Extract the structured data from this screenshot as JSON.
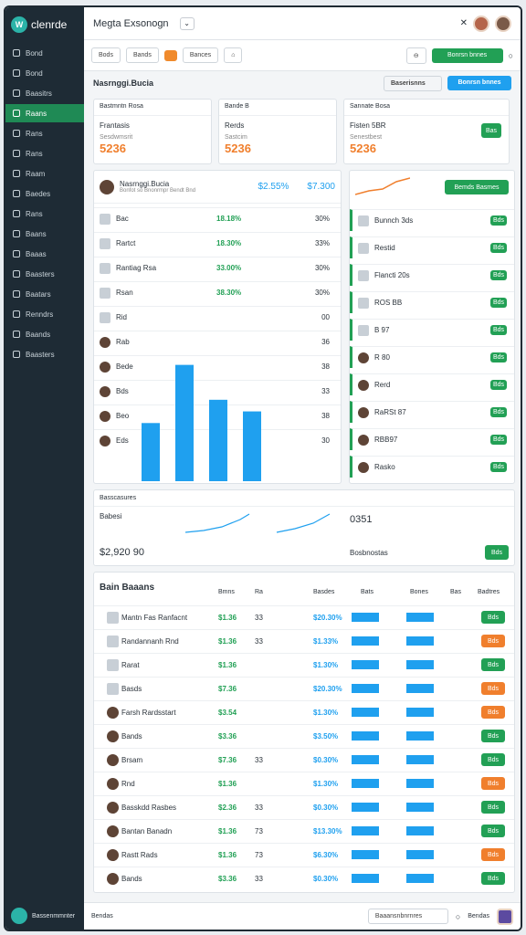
{
  "app": {
    "brand": "clenrde",
    "title": "Megta Exsonogn"
  },
  "sidebar": {
    "items": [
      "Bond",
      "Bond",
      "Baasitrs",
      "Raans",
      "Rans",
      "Rans",
      "Raam",
      "Baedes",
      "Rans",
      "Baans",
      "Baaas",
      "Baasters",
      "Baatars",
      "Renndrs",
      "Baands",
      "Baasters"
    ],
    "footer": "Bassenmmnter"
  },
  "tabs": [
    "Bods",
    "Bands",
    "",
    "Bances",
    ""
  ],
  "toolbar": {
    "search": "Baserisnns",
    "action": "Bonrsn bnnes"
  },
  "kpis": [
    {
      "head": "Bastmntn Rosa",
      "label": "Frantasis",
      "value": "5236",
      "sub": "Sesdwmsrit"
    },
    {
      "head": "Bande B",
      "label": "Rerds",
      "value": "5236",
      "sub": "Sastcim"
    },
    {
      "head": "Sannate Bosa",
      "label": "Fisten 5BR",
      "value": "5236",
      "sub": "Senestbest",
      "btn": "Bas"
    }
  ],
  "panel": {
    "title": "Nasrnggi.Bucia",
    "sub": "Bonfot so Bnonrmpr Bendt Bnd",
    "v1": "$2.55%",
    "v2": "$7.300"
  },
  "list": [
    {
      "l": "Bac",
      "v": "18.18%",
      "n": "30%"
    },
    {
      "l": "Rartct",
      "v": "18.30%",
      "n": "33%"
    },
    {
      "l": "Rantiag Rsa",
      "v": "33.00%",
      "n": "30%"
    },
    {
      "l": "Rsan",
      "v": "38.30%",
      "n": "30%"
    },
    {
      "l": "Rid",
      "v": "",
      "n": "00"
    },
    {
      "l": "Rab",
      "v": "",
      "n": "36"
    },
    {
      "l": "Bede",
      "v": "",
      "n": "38"
    },
    {
      "l": "Bds",
      "v": "",
      "n": "33"
    },
    {
      "l": "Beo",
      "v": "",
      "n": "38"
    },
    {
      "l": "Eds",
      "v": "",
      "n": "30"
    }
  ],
  "chart_data": {
    "type": "bar",
    "categories": [
      "",
      "",
      "",
      ""
    ],
    "values": [
      30,
      60,
      42,
      36
    ],
    "ylim": [
      0,
      65
    ]
  },
  "side": {
    "btn": "Bemds Basmes",
    "items": [
      "Bunnch 3ds",
      "Restid",
      "Flancti 20s",
      "ROS BB",
      "B 97",
      "R 80",
      "Rerd",
      "RaRSt 87",
      "RBB97",
      "Rasko"
    ]
  },
  "mid": {
    "head": "Basscasures",
    "left": "Babesi",
    "amount": "$2,920 90",
    "amount2": "Bosbnostas",
    "right": "0351"
  },
  "table": {
    "title": "Bain Baaans",
    "cols": [
      "Bmns",
      "Ra",
      "Basdes",
      "Bats",
      "Bones",
      "Bas",
      "Badtres"
    ],
    "rows": [
      {
        "n": "Mantn Fas Ranfacnt",
        "a": "$1.36",
        "b": "33",
        "c": "$20.30%",
        "btn": "green"
      },
      {
        "n": "Randannanh Rnd",
        "a": "$1.36",
        "b": "33",
        "c": "$1.33%",
        "btn": "orange"
      },
      {
        "n": "Rarat",
        "a": "$1.36",
        "b": "",
        "c": "$1.30%",
        "btn": "green"
      },
      {
        "n": "Basds",
        "a": "$7.36",
        "b": "",
        "c": "$20.30%",
        "btn": "orange"
      },
      {
        "n": "Farsh Rardsstart",
        "a": "$3.54",
        "b": "",
        "c": "$1.30%",
        "btn": "orange"
      },
      {
        "n": "Bands",
        "a": "$3.36",
        "b": "",
        "c": "$3.50%",
        "btn": "green"
      },
      {
        "n": "Brsam",
        "a": "$7.36",
        "b": "33",
        "c": "$0.30%",
        "btn": "green"
      },
      {
        "n": "Rnd",
        "a": "$1.36",
        "b": "",
        "c": "$1.30%",
        "btn": "orange"
      },
      {
        "n": "Basskdd Rasbes",
        "a": "$2.36",
        "b": "33",
        "c": "$0.30%",
        "btn": "green"
      },
      {
        "n": "Bantan Banadn",
        "a": "$1.36",
        "b": "73",
        "c": "$13.30%",
        "btn": "green"
      },
      {
        "n": "Rastt Rads",
        "a": "$1.36",
        "b": "73",
        "c": "$6.30%",
        "btn": "orange"
      },
      {
        "n": "Bands",
        "a": "$3.36",
        "b": "33",
        "c": "$0.30%",
        "btn": "green"
      }
    ],
    "btn": "Bds"
  },
  "footer": {
    "search": "Baaansnbnrnres",
    "user": "Bendas"
  }
}
